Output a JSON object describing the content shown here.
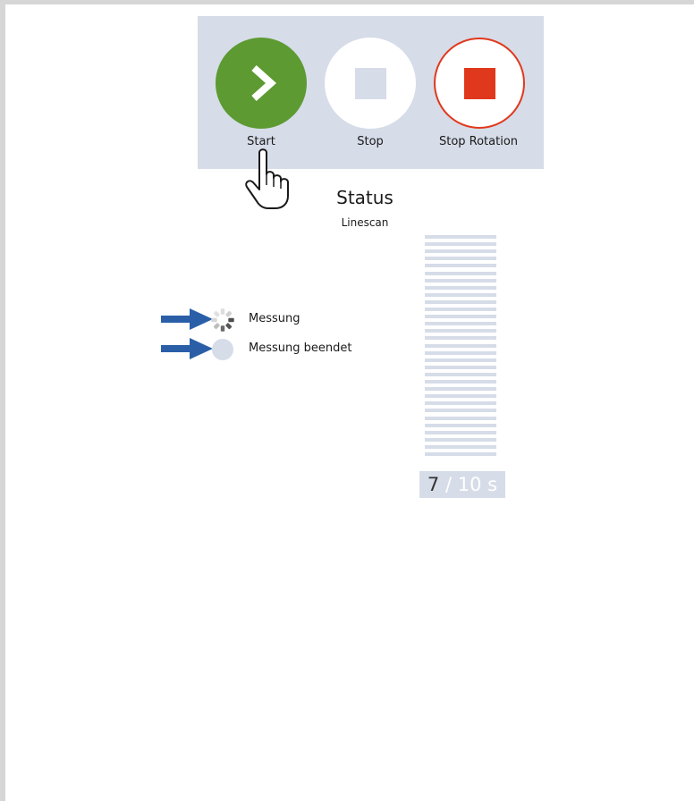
{
  "toolbar": {
    "start_label": "Start",
    "stop_label": "Stop",
    "stop_rotation_label": "Stop Rotation"
  },
  "status": {
    "title": "Status",
    "mode": "Linescan"
  },
  "progress": {
    "elapsed": "7",
    "total_suffix": " / 10  s",
    "fraction": 0.7
  },
  "legend": {
    "measuring_label": "Messung",
    "finished_label": "Messung beendet"
  },
  "colors": {
    "start_green": "#5d9a32",
    "stop_red": "#e0381c",
    "panel_bg": "#d6dce8",
    "arrow_blue": "#2a5fa8"
  },
  "icons": {
    "start": "chevron-right-icon",
    "stop": "stop-square-icon",
    "stop_rotation": "stop-rotation-icon",
    "cursor": "hand-pointer-icon",
    "measuring": "spinner-icon",
    "finished": "dot-icon",
    "annotation": "arrow-right-icon"
  }
}
